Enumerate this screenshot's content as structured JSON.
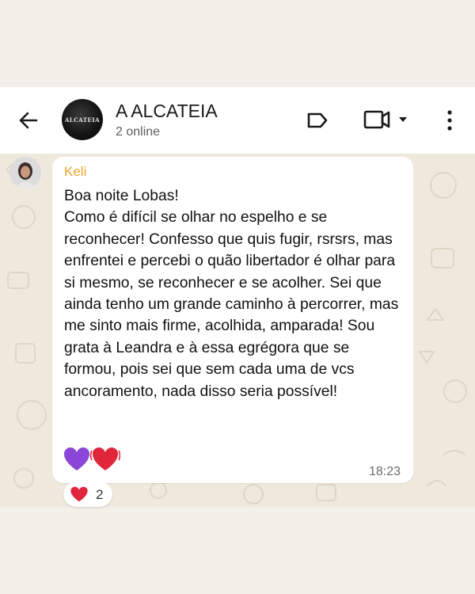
{
  "header": {
    "title": "A ALCATEIA",
    "subtitle": "2 online",
    "group_avatar_text": "ALCATEIA",
    "icons": [
      "back-arrow-icon",
      "label-icon",
      "video-call-icon",
      "chevron-down-icon",
      "more-vertical-icon"
    ]
  },
  "message": {
    "sender": "Keli",
    "sender_color": "#e7a72a",
    "text": "Boa noite Lobas!\nComo é difícil se olhar no espelho e se reconhecer! Confesso que quis fugir, rsrsrs, mas enfrentei e percebi o quão libertador é olhar para si mesmo, se reconhecer e se acolher. Sei que ainda tenho um grande caminho à percorrer, mas me sinto mais firme, acolhida, amparada! Sou grata à Leandra e à essa egrégora que se formou, pois sei que sem cada uma de vcs ancoramento, nada disso seria possível!",
    "emojis": [
      "purple-heart-icon",
      "beating-heart-icon"
    ],
    "time": "18:23"
  },
  "reaction": {
    "emoji": "red-heart-icon",
    "count": "2"
  },
  "colors": {
    "background": "#f3efe9",
    "chat_wallpaper": "#efe8dc",
    "bubble": "#ffffff"
  }
}
